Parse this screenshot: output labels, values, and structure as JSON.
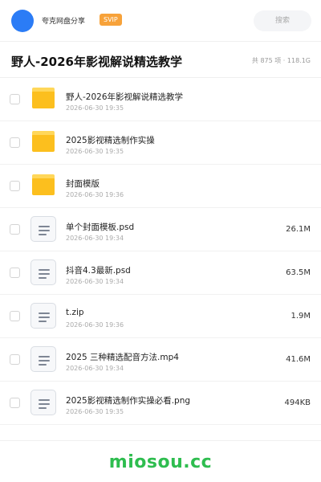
{
  "header": {
    "username": "夸克网盘分享",
    "badge": "SVIP",
    "search_label": "搜索"
  },
  "title_bar": {
    "title": "野人-2026年影视解说精选教学",
    "summary": "共 875 项 · 118.1G"
  },
  "files": [
    {
      "name": "野人-2026年影视解说精选教学",
      "date": "2026-06-30 19:35",
      "size": "",
      "icon": "folder-icon"
    },
    {
      "name": "2025影视精选制作实操",
      "date": "2026-06-30 19:35",
      "size": "",
      "icon": "folder-icon"
    },
    {
      "name": "封面模版",
      "date": "2026-06-30 19:36",
      "size": "",
      "icon": "folder-icon"
    },
    {
      "name": "单个封面模板.psd",
      "date": "2026-06-30 19:34",
      "size": "26.1M",
      "icon": "document-icon"
    },
    {
      "name": "抖音4.3最新.psd",
      "date": "2026-06-30 19:34",
      "size": "63.5M",
      "icon": "document-icon"
    },
    {
      "name": "t.zip",
      "date": "2026-06-30 19:36",
      "size": "1.9M",
      "icon": "document-icon"
    },
    {
      "name": "2025 三种精选配音方法.mp4",
      "date": "2026-06-30 19:34",
      "size": "41.6M",
      "icon": "document-icon"
    },
    {
      "name": "2025影视精选制作实操必看.png",
      "date": "2026-06-30 19:35",
      "size": "494KB",
      "icon": "document-icon"
    }
  ],
  "footer": {
    "brand": "miosou.cc"
  },
  "colors": {
    "avatar": "#2b7cf6",
    "badge": "#f7a23a",
    "folder": "#fcbf1e",
    "brand": "#2ebd4f"
  }
}
